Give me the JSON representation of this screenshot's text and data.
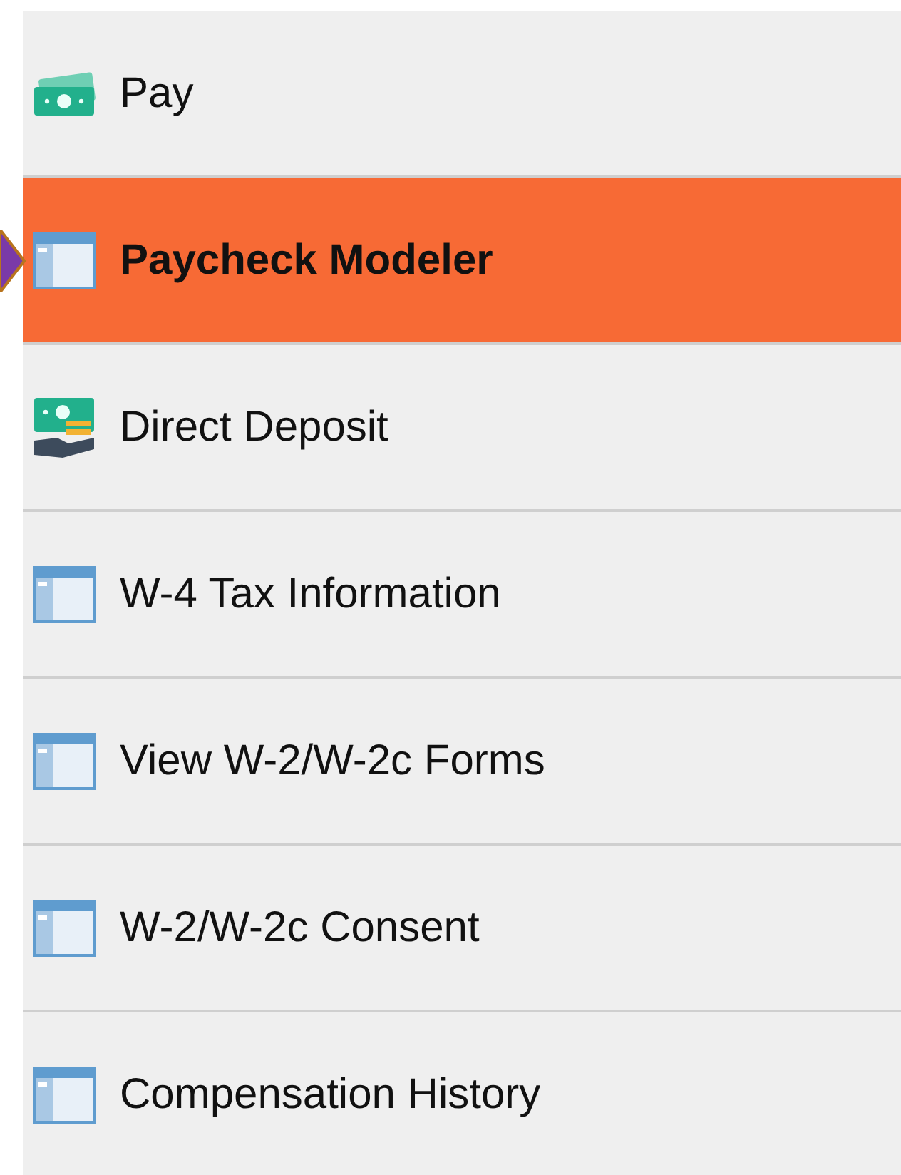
{
  "menu": {
    "items": [
      {
        "label": "Pay",
        "kind": "cash",
        "selected": false
      },
      {
        "label": "Paycheck Modeler",
        "kind": "page",
        "selected": true
      },
      {
        "label": "Direct Deposit",
        "kind": "deposit",
        "selected": false
      },
      {
        "label": "W-4 Tax Information",
        "kind": "page",
        "selected": false
      },
      {
        "label": "View W-2/W-2c Forms",
        "kind": "page",
        "selected": false
      },
      {
        "label": "W-2/W-2c Consent",
        "kind": "page",
        "selected": false
      },
      {
        "label": "Compensation History",
        "kind": "page",
        "selected": false
      }
    ]
  }
}
